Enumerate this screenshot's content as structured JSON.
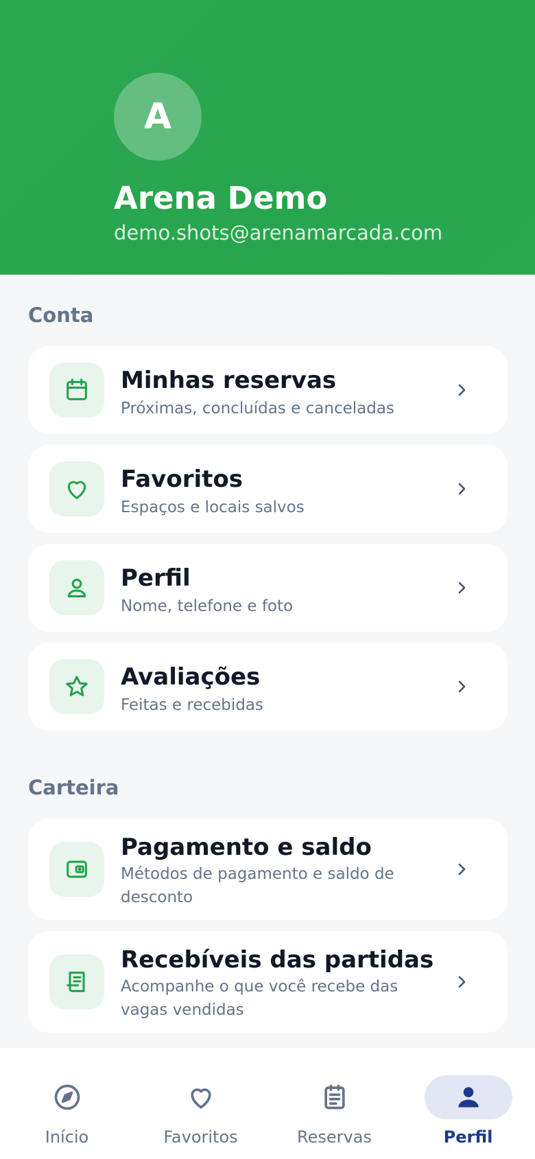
{
  "colors": {
    "header_green": "#2aa751",
    "icon_green": "#22a04b",
    "icon_bg": "#e8f5ec",
    "active_tab": "#1e3a8a",
    "active_tab_bg": "#e3e7f5",
    "muted": "#64748b"
  },
  "profile": {
    "initial": "A",
    "name": "Arena Demo",
    "email": "demo.shots@arenamarcada.com"
  },
  "sections": {
    "account": {
      "title": "Conta",
      "items": [
        {
          "title": "Minhas reservas",
          "subtitle": "Próximas, concluídas e canceladas",
          "icon": "calendar-icon"
        },
        {
          "title": "Favoritos",
          "subtitle": "Espaços e locais salvos",
          "icon": "heart-icon"
        },
        {
          "title": "Perfil",
          "subtitle": "Nome, telefone e foto",
          "icon": "person-icon"
        },
        {
          "title": "Avaliações",
          "subtitle": "Feitas e recebidas",
          "icon": "star-icon"
        }
      ]
    },
    "wallet": {
      "title": "Carteira",
      "items": [
        {
          "title": "Pagamento e saldo",
          "subtitle": "Métodos de pagamento e saldo de desconto",
          "icon": "wallet-icon"
        },
        {
          "title": "Recebíveis das partidas",
          "subtitle": "Acompanhe o que você recebe das vagas vendidas",
          "icon": "receipt-icon"
        }
      ]
    }
  },
  "tabbar": {
    "tabs": [
      {
        "label": "Início",
        "icon": "compass-icon",
        "active": false
      },
      {
        "label": "Favoritos",
        "icon": "heart-icon",
        "active": false
      },
      {
        "label": "Reservas",
        "icon": "clipboard-icon",
        "active": false
      },
      {
        "label": "Perfil",
        "icon": "person-icon",
        "active": true
      }
    ]
  }
}
